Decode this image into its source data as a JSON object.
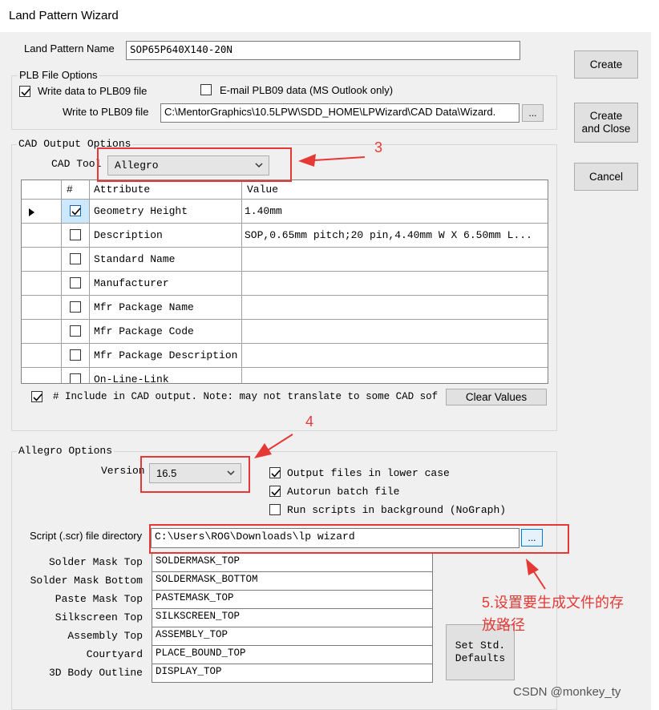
{
  "window": {
    "title": "Land Pattern Wizard"
  },
  "land_pattern_name": {
    "label": "Land Pattern Name",
    "value": "SOP65P640X140-20N"
  },
  "plb": {
    "group_title": "PLB File Options",
    "write_label": "Write data to PLB09 file",
    "email_label": "E-mail PLB09 data  (MS Outlook only)",
    "file_label": "Write to PLB09 file",
    "file_path": "C:\\MentorGraphics\\10.5LPW\\SDD_HOME\\LPWizard\\CAD Data\\Wizard.",
    "browse_label": "..."
  },
  "buttons": {
    "create": "Create",
    "create_close_1": "Create",
    "create_close_2": "and Close",
    "cancel": "Cancel"
  },
  "cad": {
    "group_title": "CAD Output Options",
    "tool_label": "CAD Tool",
    "tool_value": "Allegro",
    "columns": [
      "#",
      "Attribute",
      "Value"
    ],
    "rows": [
      {
        "attribute": "Geometry Height",
        "value": "1.40mm",
        "checked": true
      },
      {
        "attribute": "Description",
        "value": "SOP,0.65mm pitch;20 pin,4.40mm W X 6.50mm L...",
        "checked": false
      },
      {
        "attribute": "Standard Name",
        "value": "",
        "checked": false
      },
      {
        "attribute": "Manufacturer",
        "value": "",
        "checked": false
      },
      {
        "attribute": "Mfr Package Name",
        "value": "",
        "checked": false
      },
      {
        "attribute": "Mfr Package Code",
        "value": "",
        "checked": false
      },
      {
        "attribute": "Mfr Package Description",
        "value": "",
        "checked": false
      },
      {
        "attribute": "On-Line-Link",
        "value": "",
        "checked": false
      }
    ],
    "include_label": "# Include in CAD output.  Note: may not translate to some CAD sof",
    "clear_label": "Clear Values"
  },
  "allegro": {
    "group_title": "Allegro Options",
    "version_label": "Version",
    "version_value": "16.5",
    "lower_case_label": "Output files in lower case",
    "autorun_label": "Autorun batch file",
    "background_label": "Run scripts in background (NoGraph)",
    "script_label": "Script (.scr) file directory",
    "script_path": "C:\\Users\\ROG\\Downloads\\lp wizard",
    "script_browse": "...",
    "layers": [
      {
        "label": "Solder Mask Top",
        "value": "SOLDERMASK_TOP"
      },
      {
        "label": "Solder Mask Bottom",
        "value": "SOLDERMASK_BOTTOM"
      },
      {
        "label": "Paste Mask Top",
        "value": "PASTEMASK_TOP"
      },
      {
        "label": "Silkscreen Top",
        "value": "SILKSCREEN_TOP"
      },
      {
        "label": "Assembly Top",
        "value": "ASSEMBLY_TOP"
      },
      {
        "label": "Courtyard",
        "value": "PLACE_BOUND_TOP"
      },
      {
        "label": "3D Body Outline",
        "value": "DISPLAY_TOP"
      }
    ],
    "set_std_1": "Set Std.",
    "set_std_2": "Defaults"
  },
  "annotations": {
    "a3": "3",
    "a4": "4",
    "a5_line1": "5.设置要生成文件的存",
    "a5_line2": "放路径",
    "color": "#e53935"
  },
  "watermark": "CSDN @monkey_ty"
}
